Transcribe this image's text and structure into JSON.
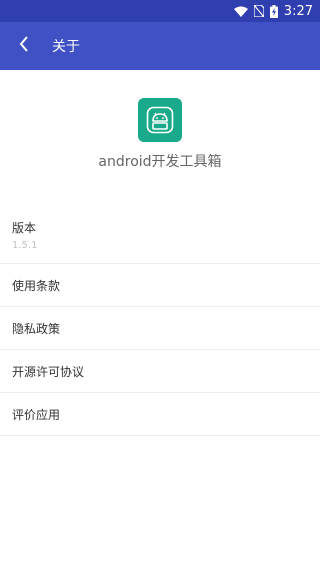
{
  "status_bar": {
    "time": "3:27",
    "icons": [
      "wifi-icon",
      "no-sim-icon",
      "battery-charging-icon"
    ]
  },
  "app_bar": {
    "title": "关于",
    "back_icon": "back-arrow-icon"
  },
  "app": {
    "name": "android开发工具箱",
    "icon": "android-toolbox-icon",
    "icon_color": "#1aa98a"
  },
  "list": {
    "version": {
      "label": "版本",
      "value": "1.5.1"
    },
    "terms": "使用条款",
    "privacy": "隐私政策",
    "license": "开源许可协议",
    "rate": "评价应用"
  },
  "colors": {
    "status_bar": "#2f3fb0",
    "app_bar": "#3f51c4",
    "background": "#ffffff"
  }
}
